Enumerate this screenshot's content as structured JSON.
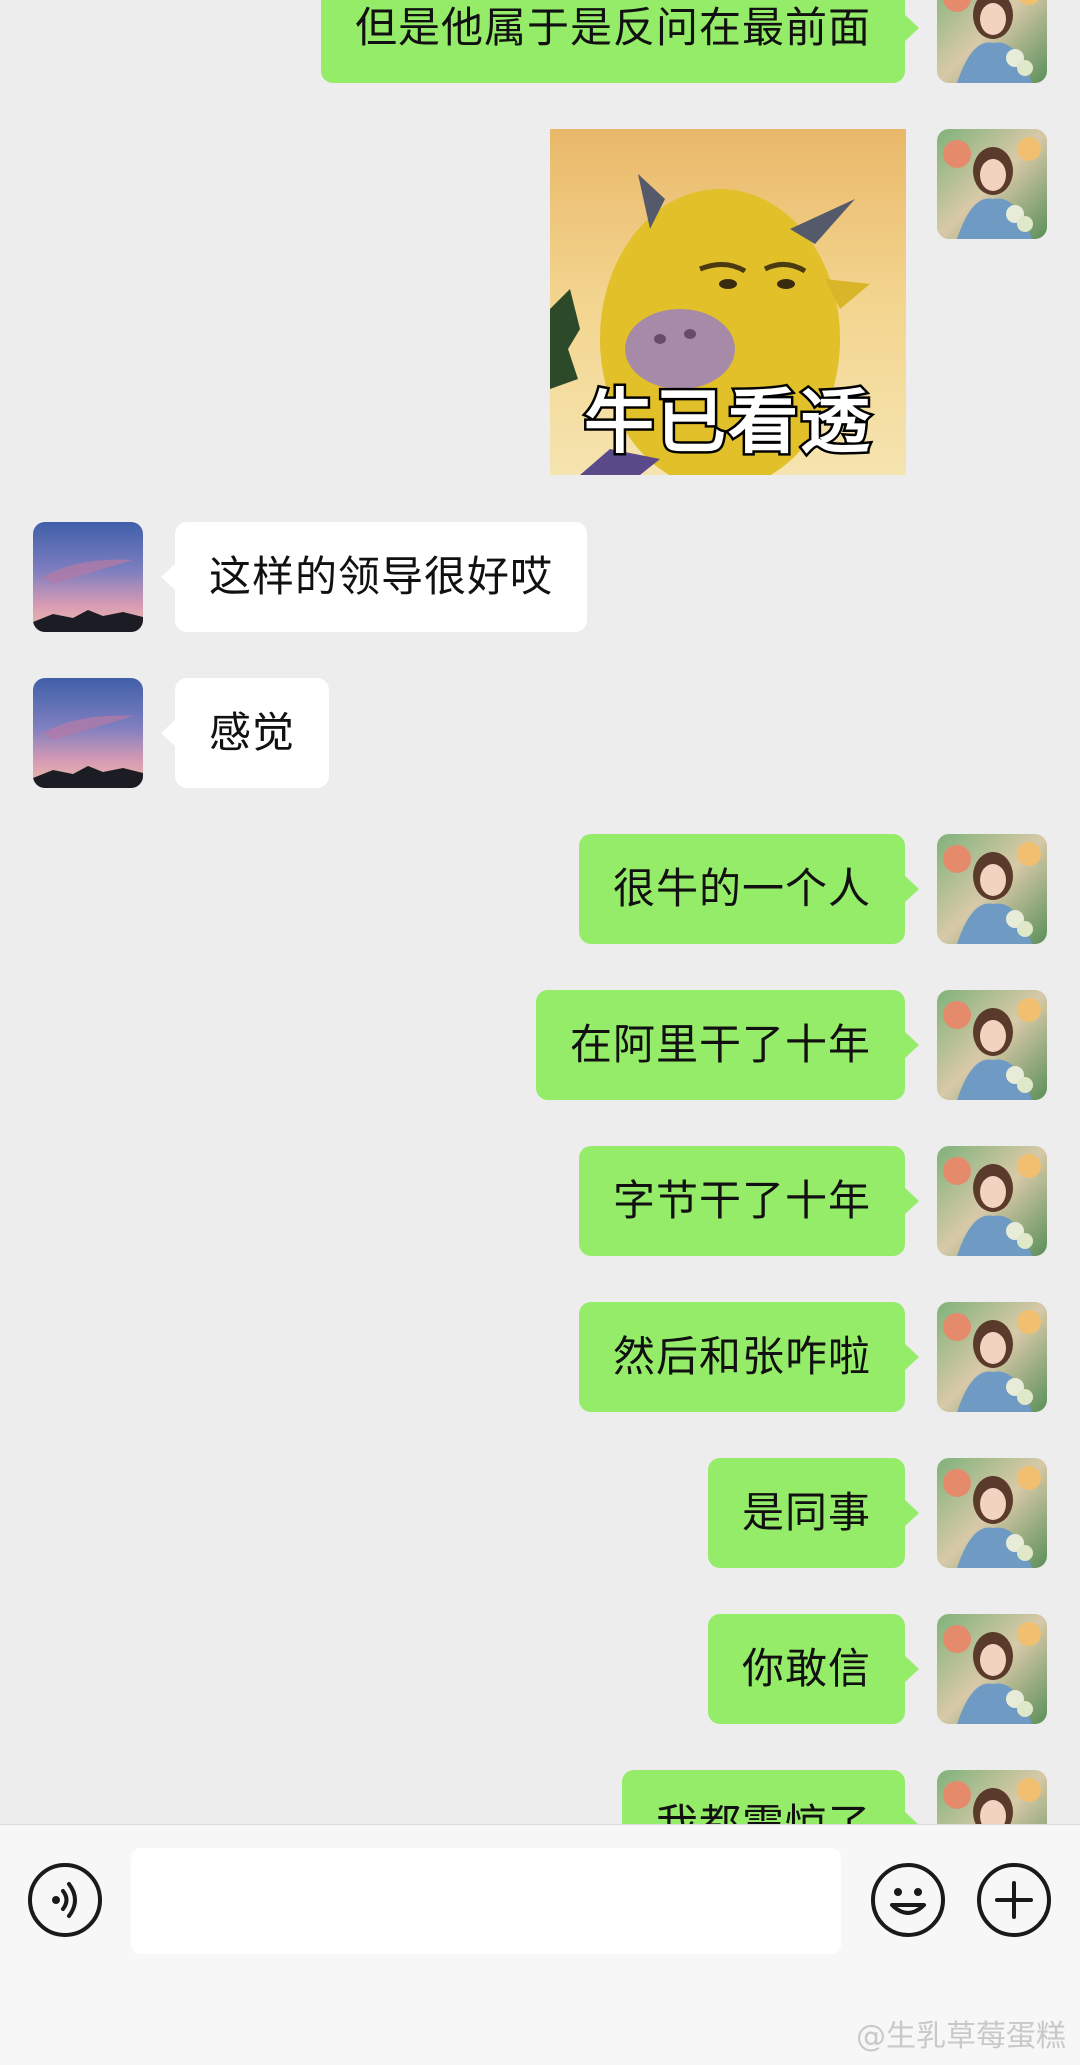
{
  "messages": [
    {
      "side": "mine",
      "text": "但是他属于是反问在最前面"
    },
    {
      "side": "mine",
      "type": "sticker",
      "caption": "牛已看透"
    },
    {
      "side": "theirs",
      "text": "这样的领导很好哎"
    },
    {
      "side": "theirs",
      "text": "感觉"
    },
    {
      "side": "mine",
      "text": "很牛的一个人"
    },
    {
      "side": "mine",
      "text": "在阿里干了十年"
    },
    {
      "side": "mine",
      "text": "字节干了十年"
    },
    {
      "side": "mine",
      "text": "然后和张咋啦"
    },
    {
      "side": "mine",
      "text": "是同事"
    },
    {
      "side": "mine",
      "text": "你敢信"
    },
    {
      "side": "mine",
      "text": "我都震惊了"
    }
  ],
  "input": {
    "placeholder": "",
    "voice_icon": "voice-icon",
    "emoji_icon": "emoji-icon",
    "plus_icon": "plus-icon"
  },
  "watermark": "@生乳草莓蛋糕",
  "colors": {
    "background": "#ededed",
    "mine_bubble": "#95ec69",
    "theirs_bubble": "#ffffff",
    "input_bar": "#f7f7f7"
  }
}
